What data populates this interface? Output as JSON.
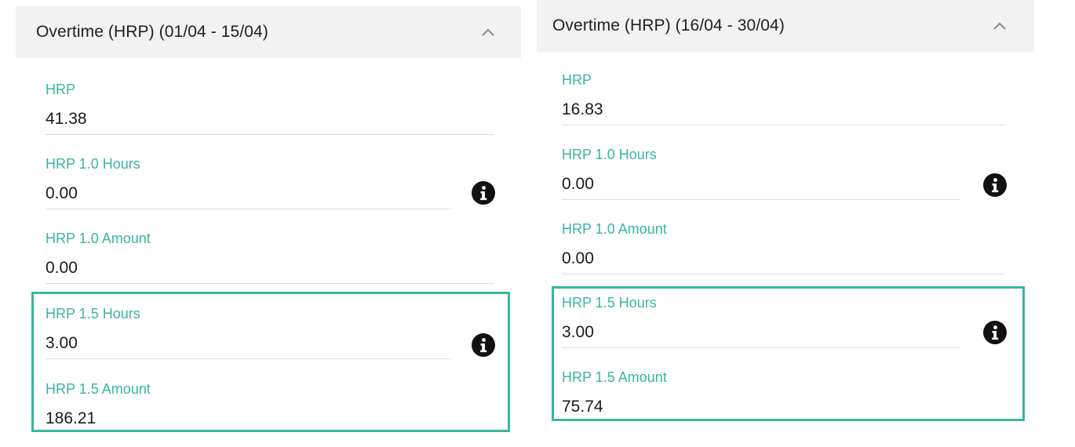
{
  "accent_color": "#3ab5a0",
  "panels": [
    {
      "title": "Overtime (HRP) (01/04 - 15/04)",
      "collapse_icon": "chevron-up-icon",
      "fields": [
        {
          "label": "HRP",
          "value": "41.38"
        },
        {
          "label": "HRP 1.0 Hours",
          "value": "0.00",
          "info_icon": "info-icon"
        },
        {
          "label": "HRP 1.0 Amount",
          "value": "0.00"
        },
        {
          "label": "HRP 1.5 Hours",
          "value": "3.00",
          "info_icon": "info-icon"
        },
        {
          "label": "HRP 1.5 Amount",
          "value": "186.21"
        }
      ]
    },
    {
      "title": "Overtime (HRP) (16/04 - 30/04)",
      "collapse_icon": "chevron-up-icon",
      "fields": [
        {
          "label": "HRP",
          "value": "16.83"
        },
        {
          "label": "HRP 1.0 Hours",
          "value": "0.00",
          "info_icon": "info-icon"
        },
        {
          "label": "HRP 1.0 Amount",
          "value": "0.00"
        },
        {
          "label": "HRP 1.5 Hours",
          "value": "3.00",
          "info_icon": "info-icon"
        },
        {
          "label": "HRP 1.5 Amount",
          "value": "75.74"
        }
      ]
    }
  ]
}
